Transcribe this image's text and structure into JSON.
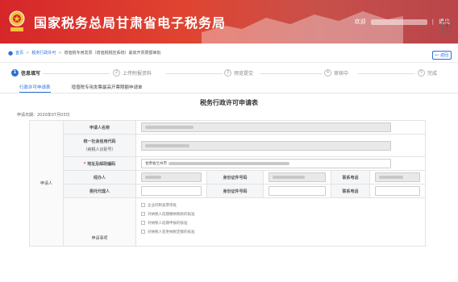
{
  "header": {
    "site_title": "国家税务总局甘肃省电子税务局",
    "welcome": "欢迎",
    "separator": "|",
    "logout": "退出",
    "colors": {
      "primary": "#d6262a",
      "accent": "#2a6fd6"
    }
  },
  "breadcrumb": {
    "home": "首页",
    "gt1": ">",
    "section": "税务行政许可",
    "gt2": ">",
    "current": "增值税专用发票（增值税税控系统）最高开票限额审批",
    "back": "返回"
  },
  "help": "?",
  "steps": [
    {
      "num": "1",
      "label": "信息填写"
    },
    {
      "num": "2",
      "label": "上传附报资料"
    },
    {
      "num": "3",
      "label": "预览提交"
    },
    {
      "num": "4",
      "label": "审核中"
    },
    {
      "num": "5",
      "label": "完成"
    }
  ],
  "tabs": [
    "行政许可申请表",
    "增值税专用发票最高开票限额申请单"
  ],
  "form": {
    "title": "税务行政许可申请表",
    "apply_date": "申请日期：2020年07月03日",
    "applicant_section": "申请人",
    "name_label": "申请人名称",
    "credit_code_label": "统一社会信用代码",
    "taxpayer_id_label": "（纳税人识别号）",
    "required_mark": "*",
    "address_label": "地址及邮政编码",
    "address_value": "甘肃省兰州市",
    "handler_label": "经办人",
    "id_no_label": "身份证件号码",
    "phone_label": "联系电话",
    "agent_label": "委托代理人",
    "matters_section": "申请事项",
    "options": [
      "企业印制发票审批",
      "对纳税人延期缴纳税款的核准",
      "对纳税人延期申报的核准",
      "对纳税人变更纳税定额的核准"
    ]
  }
}
